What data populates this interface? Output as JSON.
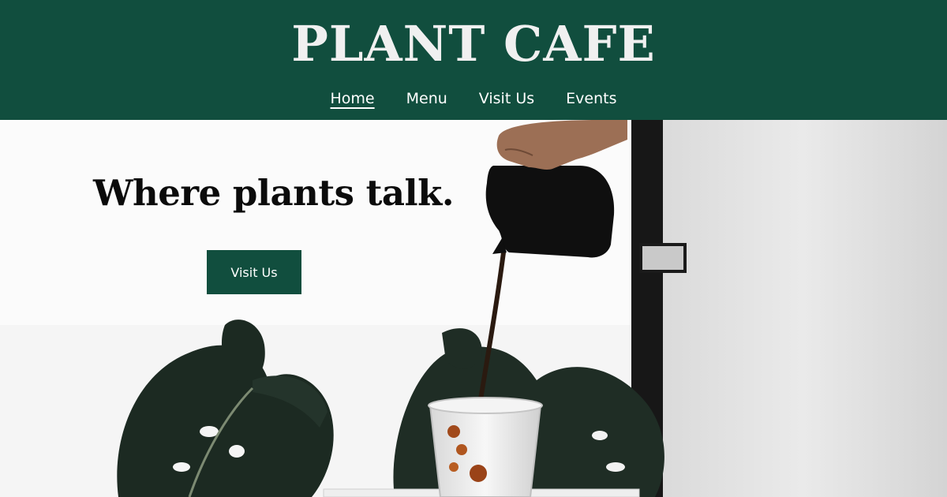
{
  "header": {
    "brand": "PLANT CAFE",
    "nav": [
      {
        "label": "Home",
        "active": true
      },
      {
        "label": "Menu"
      },
      {
        "label": "Visit Us"
      },
      {
        "label": "Events"
      }
    ]
  },
  "hero": {
    "tagline": "Where plants talk.",
    "cta_label": "Visit Us"
  },
  "colors": {
    "brand_green": "#114e3e",
    "header_text": "#f0f0f0"
  }
}
